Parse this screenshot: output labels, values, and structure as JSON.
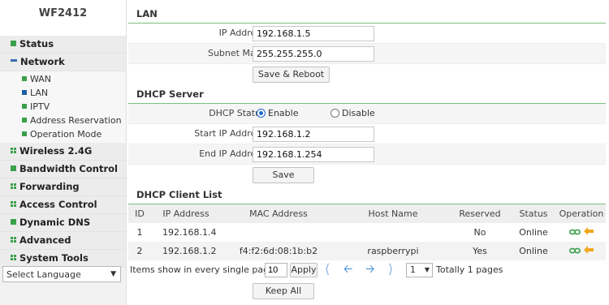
{
  "sidebar": {
    "brand": "WF2412",
    "menu": [
      {
        "label": "Status"
      },
      {
        "label": "Network"
      },
      {
        "label": "Wireless 2.4G"
      },
      {
        "label": "Bandwidth Control"
      },
      {
        "label": "Forwarding"
      },
      {
        "label": "Access Control"
      },
      {
        "label": "Dynamic DNS"
      },
      {
        "label": "Advanced"
      },
      {
        "label": "System Tools"
      }
    ],
    "network_sub": [
      {
        "label": "WAN"
      },
      {
        "label": "LAN"
      },
      {
        "label": "IPTV"
      },
      {
        "label": "Address Reservation"
      },
      {
        "label": "Operation Mode"
      }
    ],
    "language": "Select Language"
  },
  "lan": {
    "title": "LAN",
    "ip_label": "IP Address :",
    "ip_value": "192.168.1.5",
    "mask_label": "Subnet Mask :",
    "mask_value": "255.255.255.0",
    "save_reboot": "Save & Reboot"
  },
  "dhcp": {
    "title": "DHCP Server",
    "status_label": "DHCP Status :",
    "enable": "Enable",
    "disable": "Disable",
    "start_label": "Start IP Address :",
    "start_value": "192.168.1.2",
    "end_label": "End IP Address :",
    "end_value": "192.168.1.254",
    "save": "Save"
  },
  "clients": {
    "title": "DHCP Client List",
    "headers": [
      "ID",
      "IP Address",
      "MAC Address",
      "Host Name",
      "Reserved",
      "Status",
      "Operation"
    ],
    "rows": [
      {
        "id": "1",
        "ip": "192.168.1.4",
        "mac": "",
        "host": "",
        "reserved": "No",
        "status": "Online"
      },
      {
        "id": "2",
        "ip": "192.168.1.2",
        "mac": "f4:f2:6d:08:1b:b2",
        "host": "raspberrypi",
        "reserved": "Yes",
        "status": "Online"
      }
    ],
    "pager": {
      "items_text": "Items show in every single page",
      "per_page": "10",
      "apply": "Apply",
      "page": "1",
      "total": "Totally 1 pages"
    },
    "keep_all": "Keep All"
  },
  "colors": {
    "accent_green": "#3aa04a",
    "link_blue": "#1e7fd8",
    "arrow_orange": "#f0a81c"
  }
}
